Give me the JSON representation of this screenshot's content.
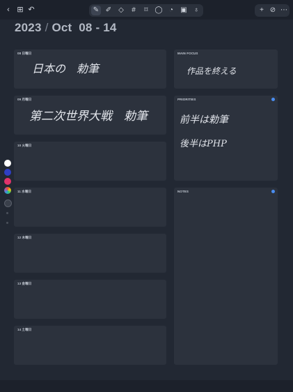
{
  "toolbar": {
    "left": [
      {
        "name": "back-icon",
        "glyph": "‹"
      },
      {
        "name": "grid-icon",
        "glyph": "⊞"
      },
      {
        "name": "undo-icon",
        "glyph": "↶"
      }
    ],
    "tools": [
      {
        "name": "pen-icon",
        "glyph": "✎"
      },
      {
        "name": "highlighter-icon",
        "glyph": "✐"
      },
      {
        "name": "eraser-icon",
        "glyph": "◇"
      },
      {
        "name": "hashtag-icon",
        "glyph": "#"
      },
      {
        "name": "bookmark-icon",
        "glyph": "⌑"
      },
      {
        "name": "lasso-icon",
        "glyph": "◯"
      },
      {
        "name": "comment-icon",
        "glyph": "◔"
      },
      {
        "name": "image-icon",
        "glyph": "▣"
      },
      {
        "name": "microphone-icon",
        "glyph": "♁"
      }
    ],
    "right": [
      {
        "name": "add-icon",
        "glyph": "+"
      },
      {
        "name": "no-sync-icon",
        "glyph": "⊘"
      },
      {
        "name": "more-icon",
        "glyph": "⋯"
      }
    ]
  },
  "header": {
    "year": "2023",
    "separator": "/",
    "range": "Oct  08 - 14"
  },
  "days": [
    {
      "label": "08 日曜日",
      "handwriting": "日本の　勅筆"
    },
    {
      "label": "09 月曜日",
      "handwriting": "第二次世界大戦　勅筆"
    },
    {
      "label": "10 火曜日",
      "handwriting": ""
    },
    {
      "label": "11 水曜日",
      "handwriting": ""
    },
    {
      "label": "12 木曜日",
      "handwriting": ""
    },
    {
      "label": "13 金曜日",
      "handwriting": ""
    },
    {
      "label": "14 土曜日",
      "handwriting": ""
    }
  ],
  "main_focus": {
    "label": "MAIN FOCUS",
    "handwriting": "作品を終える"
  },
  "priorities": {
    "label": "PRIORITIES",
    "line1": "前半は勅筆",
    "line2": "後半はPHP"
  },
  "notes": {
    "label": "NOTES"
  },
  "palette": {
    "colors": [
      "#ffffff",
      "#2f3fc4",
      "#e0336b"
    ],
    "accent": "#4a8df0"
  }
}
